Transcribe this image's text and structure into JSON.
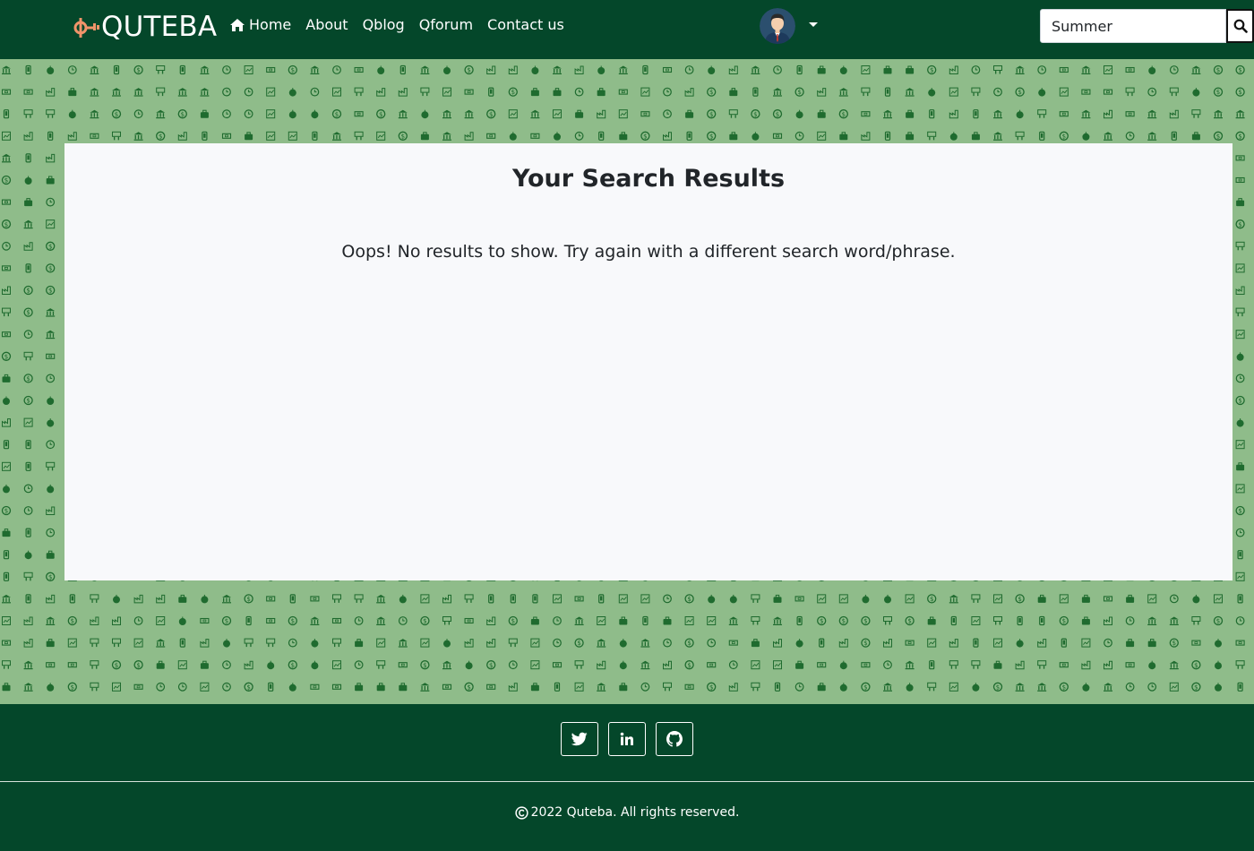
{
  "brand": {
    "name": "QUTEBA"
  },
  "nav": {
    "items": [
      {
        "label": "Home"
      },
      {
        "label": "About"
      },
      {
        "label": "Qblog"
      },
      {
        "label": "Qforum"
      },
      {
        "label": "Contact us"
      }
    ]
  },
  "search": {
    "value": "Summer"
  },
  "main": {
    "title": "Your Search Results",
    "message": "Oops! No results to show. Try again with a different search word/phrase."
  },
  "footer": {
    "social": [
      {
        "icon": "twitter-icon"
      },
      {
        "icon": "linkedin-icon"
      },
      {
        "icon": "github-icon"
      }
    ],
    "copyright": "2022 Quteba. All rights reserved."
  },
  "colors": {
    "nav_bg": "#04472a",
    "pattern_bg": "#8fbc8a",
    "pattern_icon": "#1f6b2f",
    "brand_accent": "#f0946a",
    "card_bg": "#f8f9fb"
  }
}
